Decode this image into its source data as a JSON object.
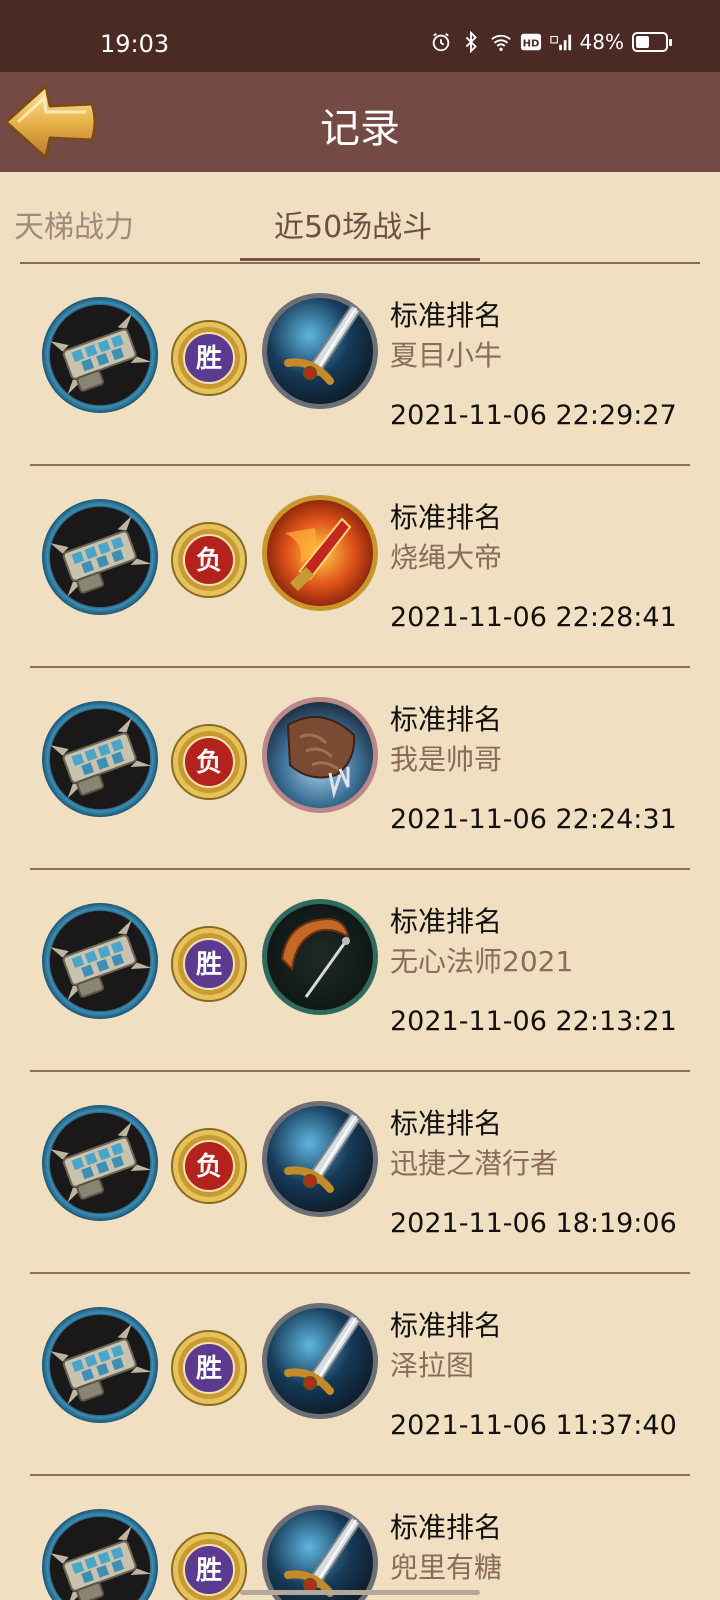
{
  "status_bar": {
    "time": "19:03",
    "battery_percent": "48%",
    "battery_level": 0.48,
    "icons": [
      "alarm-icon",
      "bluetooth-icon",
      "wifi-icon",
      "hd-icon",
      "4g-signal-icon",
      "battery-icon"
    ],
    "network_label": "HD"
  },
  "header": {
    "title": "记录",
    "back_icon": "back-arrow-icon"
  },
  "tabs": [
    {
      "label": "天梯战力",
      "active": false
    },
    {
      "label": "近50场战斗",
      "active": true
    }
  ],
  "records": [
    {
      "mode": "标准排名",
      "opponent": "夏目小牛",
      "time": "2021-11-06 22:29:27",
      "result": "胜",
      "opponent_icon": "sword-icon"
    },
    {
      "mode": "标准排名",
      "opponent": "烧绳大帝",
      "time": "2021-11-06 22:28:41",
      "result": "负",
      "opponent_icon": "flame-blade-icon"
    },
    {
      "mode": "标准排名",
      "opponent": "我是帅哥",
      "time": "2021-11-06 22:24:31",
      "result": "负",
      "opponent_icon": "beast-claw-icon"
    },
    {
      "mode": "标准排名",
      "opponent": "无心法师2021",
      "time": "2021-11-06 22:13:21",
      "result": "胜",
      "opponent_icon": "sickle-icon"
    },
    {
      "mode": "标准排名",
      "opponent": "迅捷之潜行者",
      "time": "2021-11-06 18:19:06",
      "result": "负",
      "opponent_icon": "sword-icon"
    },
    {
      "mode": "标准排名",
      "opponent": "泽拉图",
      "time": "2021-11-06 11:37:40",
      "result": "胜",
      "opponent_icon": "sword-icon"
    },
    {
      "mode": "标准排名",
      "opponent": "兜里有糖",
      "time": "",
      "result": "胜",
      "opponent_icon": "sword-icon"
    }
  ],
  "colors": {
    "background": "#f0dfc0",
    "header": "#744b44",
    "status_bar": "#4c2a24",
    "win_badge": "#5b3a8f",
    "loss_badge": "#b3221c",
    "badge_rim": "#d8b04a",
    "opponent_name": "#8a6b5c"
  }
}
